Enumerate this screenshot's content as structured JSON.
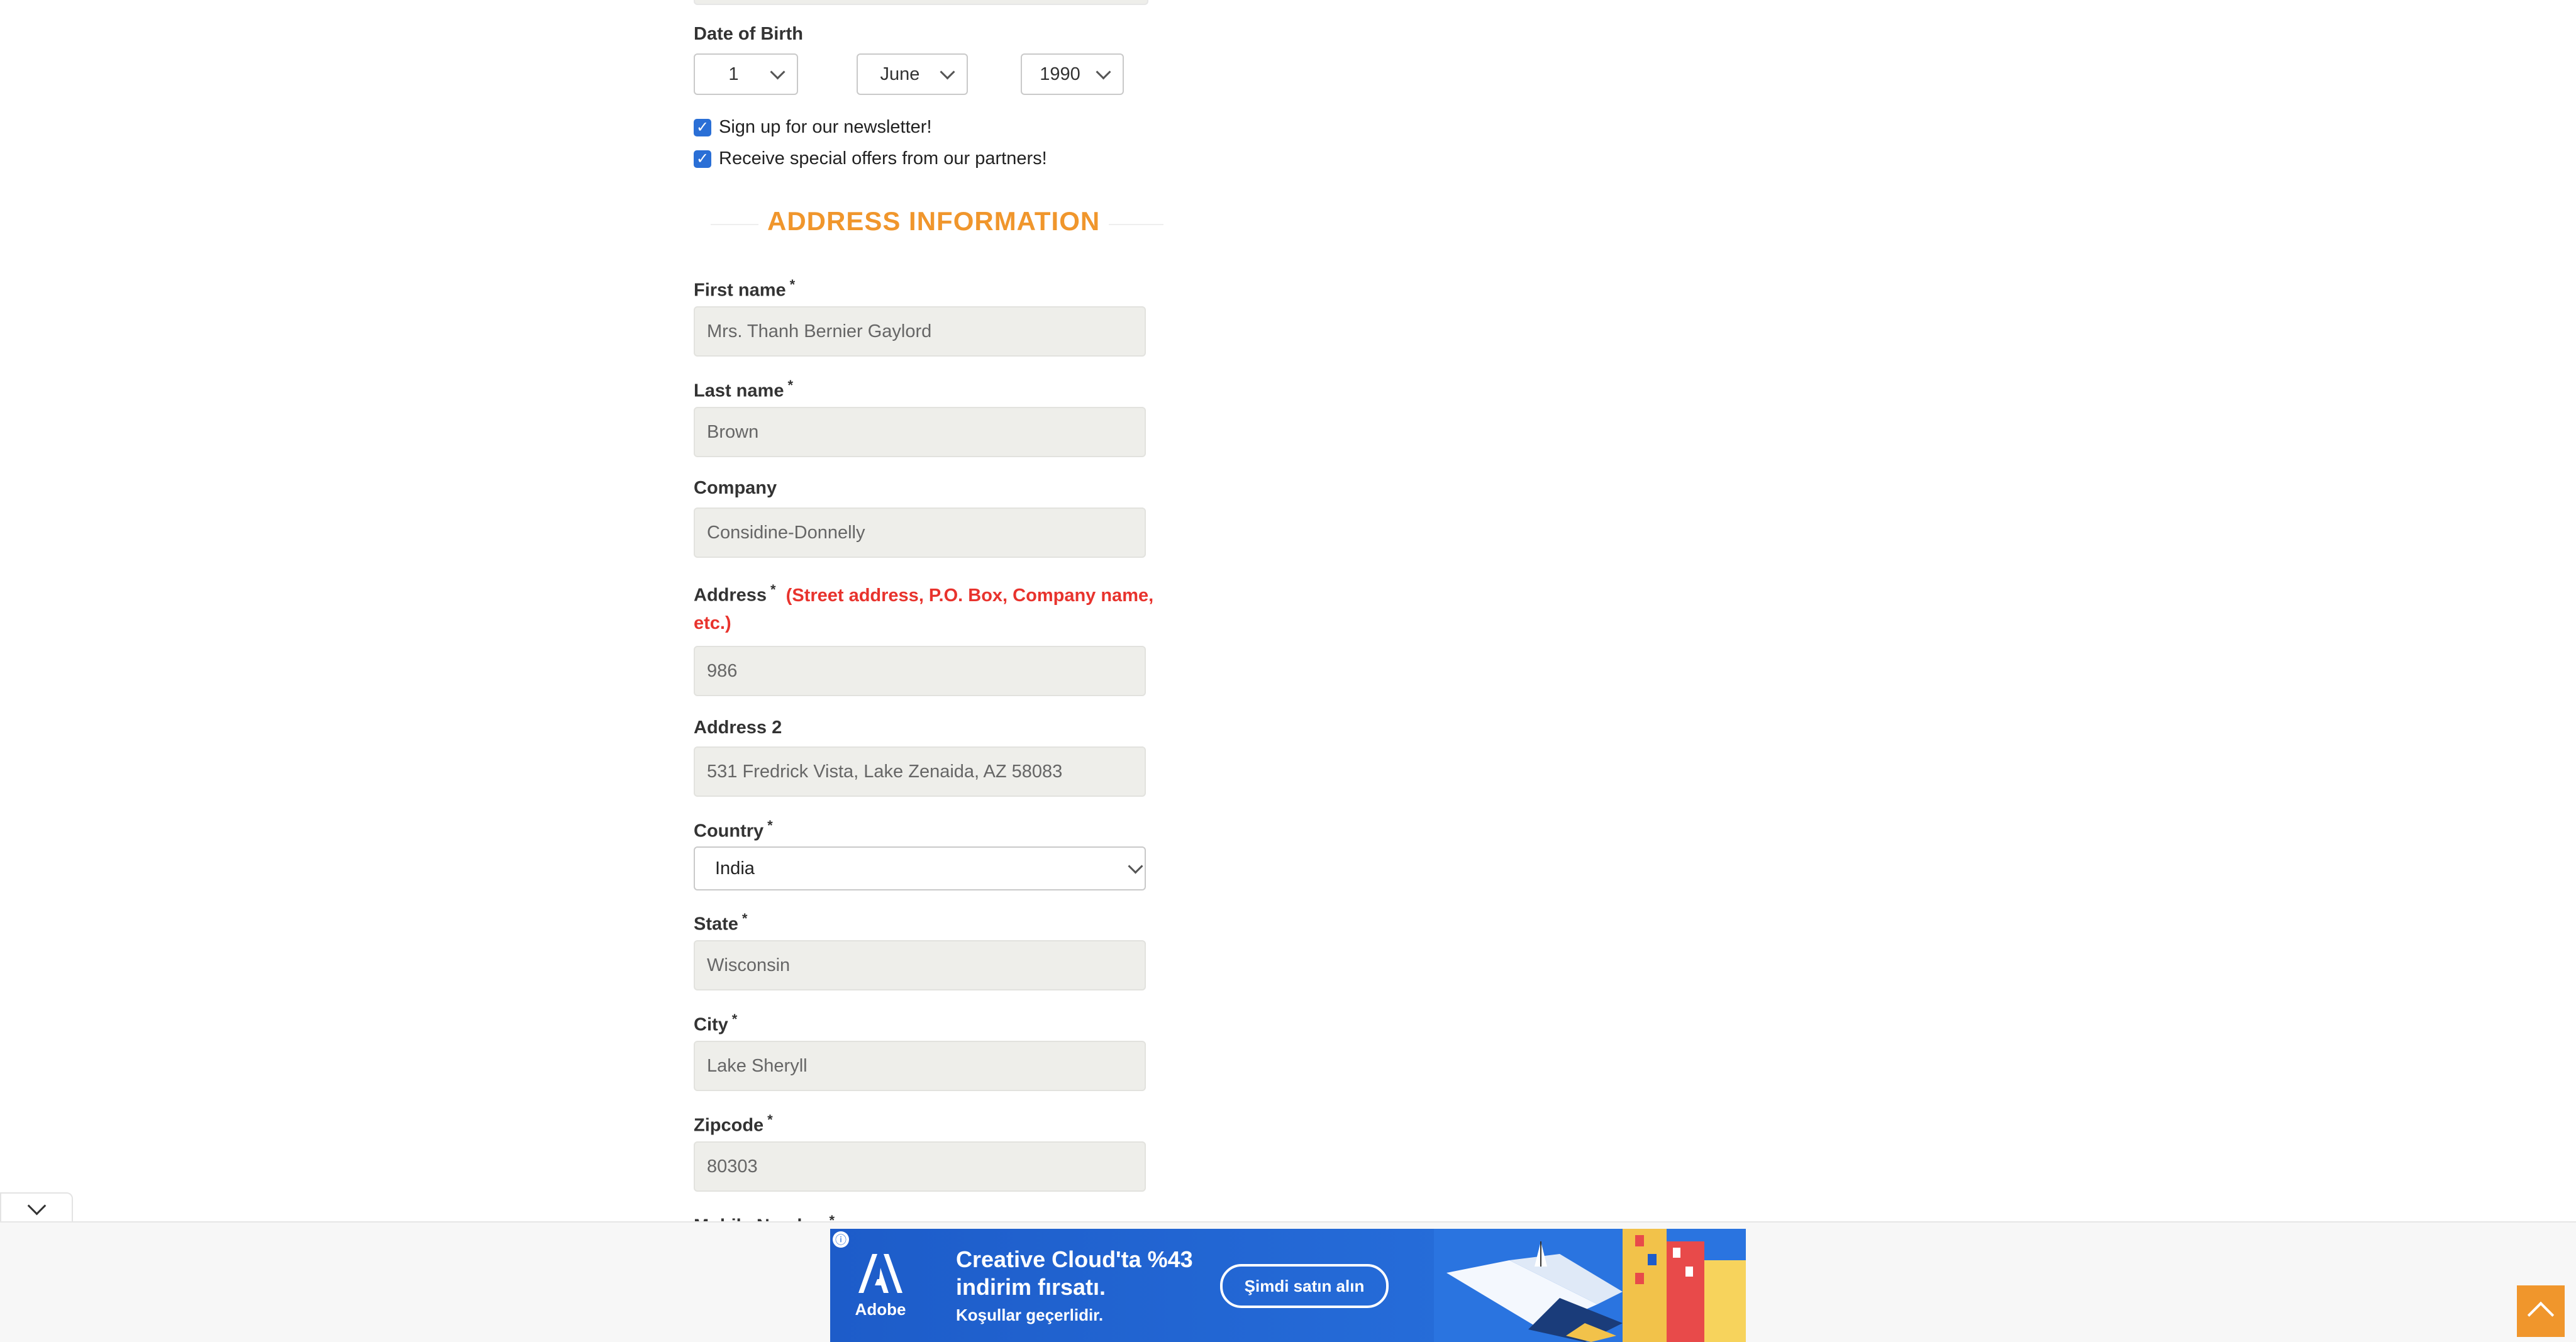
{
  "dob": {
    "label": "Date of Birth",
    "day": "1",
    "month": "June",
    "year": "1990"
  },
  "checkboxes": {
    "newsletter": "Sign up for our newsletter!",
    "offers": "Receive special offers from our partners!"
  },
  "section_title": "ADDRESS INFORMATION",
  "required_mark": "*",
  "fields": {
    "first_name": {
      "label": "First name",
      "value": "Mrs. Thanh Bernier Gaylord"
    },
    "last_name": {
      "label": "Last name",
      "value": "Brown"
    },
    "company": {
      "label": "Company",
      "value": "Considine-Donnelly"
    },
    "address": {
      "label": "Address",
      "hint_line1": "(Street address, P.O. Box, Company name,",
      "hint_line2": "etc.)",
      "value": "986"
    },
    "address2": {
      "label": "Address 2",
      "value": "531 Fredrick Vista, Lake Zenaida, AZ 58083"
    },
    "country": {
      "label": "Country",
      "value": "India"
    },
    "state": {
      "label": "State",
      "value": "Wisconsin"
    },
    "city": {
      "label": "City",
      "value": "Lake Sheryll"
    },
    "zipcode": {
      "label": "Zipcode",
      "value": "80303"
    },
    "mobile": {
      "label": "Mobile Number"
    }
  },
  "ad": {
    "brand": "Adobe",
    "line1": "Creative Cloud'ta %43",
    "line2": "indirim fırsatı.",
    "line3": "Koşullar geçerlidir.",
    "cta": "Şimdi satın alın",
    "close": "✕",
    "choice_icon": "ⓘ"
  },
  "colors": {
    "accent": "#f0962c",
    "error_red": "#e8332d",
    "checkbox_blue": "#2a6fd6",
    "ad_blue": "#2469d6"
  },
  "icons": [
    "chevron-down-icon",
    "check-icon",
    "arrow-up-icon",
    "adobe-logo-icon",
    "close-icon",
    "ad-choices-icon"
  ]
}
